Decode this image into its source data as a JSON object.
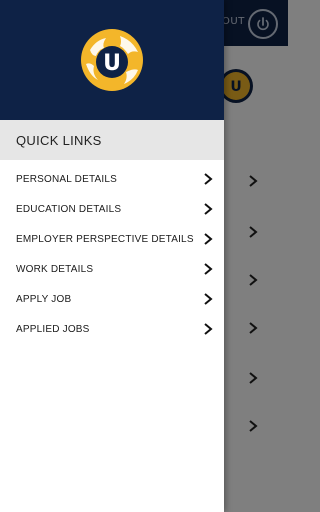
{
  "app": {
    "logo_letter": "U",
    "colors": {
      "header_bg": "#0e2246",
      "logo_yellow": "#f3b62a",
      "logo_blue": "#0e2246",
      "quick_links_bg": "#e6e6e6",
      "scrim": "rgba(0,0,0,0.5)"
    }
  },
  "background": {
    "logout_label": "OUT",
    "power_icon": "power-icon"
  },
  "drawer": {
    "quick_links_title": "QUICK LINKS",
    "items": [
      {
        "label": "PERSONAL DETAILS",
        "icon": "chevron-right-icon"
      },
      {
        "label": "EDUCATION DETAILS",
        "icon": "chevron-right-icon"
      },
      {
        "label": "EMPLOYER PERSPECTIVE DETAILS",
        "icon": "chevron-right-icon"
      },
      {
        "label": "WORK DETAILS",
        "icon": "chevron-right-icon"
      },
      {
        "label": "APPLY JOB",
        "icon": "chevron-right-icon"
      },
      {
        "label": "APPLIED JOBS",
        "icon": "chevron-right-icon"
      }
    ]
  }
}
